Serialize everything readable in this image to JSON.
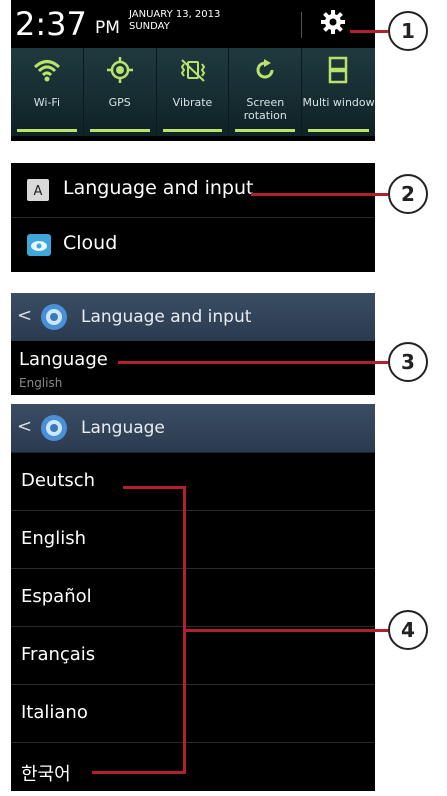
{
  "status_bar": {
    "time": "2:37",
    "ampm": "PM",
    "date_line1": "JANUARY 13, 2013",
    "date_line2": "SUNDAY"
  },
  "quick_settings": [
    {
      "label": "Wi-Fi",
      "icon": "wifi-icon"
    },
    {
      "label": "GPS",
      "icon": "gps-icon"
    },
    {
      "label": "Vibrate",
      "icon": "vibrate-icon"
    },
    {
      "label": "Screen rotation",
      "icon": "screen-rotation-icon"
    },
    {
      "label": "Multi window",
      "icon": "multi-window-icon"
    }
  ],
  "settings_list": {
    "items": [
      {
        "label": "Language and input",
        "icon": "language-input-icon"
      },
      {
        "label": "Cloud",
        "icon": "cloud-icon"
      }
    ]
  },
  "language_input_screen": {
    "title": "Language and input",
    "language_item": {
      "label": "Language",
      "value": "English"
    }
  },
  "language_screen": {
    "title": "Language",
    "languages": [
      "Deutsch",
      "English",
      "Español",
      "Français",
      "Italiano",
      "한국어"
    ]
  },
  "callouts": [
    "1",
    "2",
    "3",
    "4"
  ],
  "colors": {
    "callout_line": "#b2202e",
    "tile_indicator": "#b9e36a",
    "action_bar": "#34475c"
  }
}
